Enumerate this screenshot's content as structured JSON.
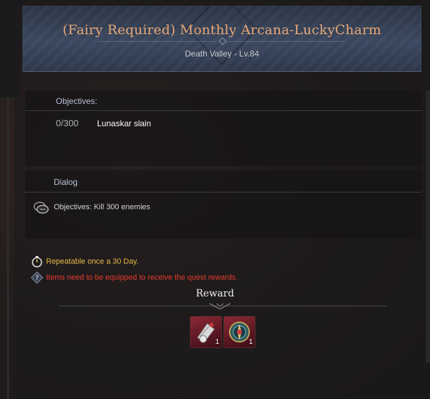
{
  "quest": {
    "title": "(Fairy Required) Monthly Arcana-LuckyCharm",
    "location": "Death Valley - Lv.84"
  },
  "objectives": {
    "heading": "Objectives:",
    "items": [
      {
        "count": "0/300",
        "text": "Lunaskar slain"
      }
    ]
  },
  "dialog": {
    "heading": "Dialog",
    "text": "Objectives: Kill 300 enemies",
    "icon": "speech-bubble-icon"
  },
  "notes": {
    "repeat": "Repeatable once a 30 Day.",
    "equip": "Items need to be equipped to receive the quest rewards."
  },
  "reward": {
    "heading": "Reward",
    "items": [
      {
        "icon": "scroll-reward-icon",
        "quantity": "1"
      },
      {
        "icon": "compass-charm-reward-icon",
        "quantity": "1"
      }
    ]
  },
  "colors": {
    "title": "#e8a877",
    "repeat_note": "#e5b84a",
    "warning_note": "#e53a2e",
    "item_frame": "#8d2a35"
  }
}
